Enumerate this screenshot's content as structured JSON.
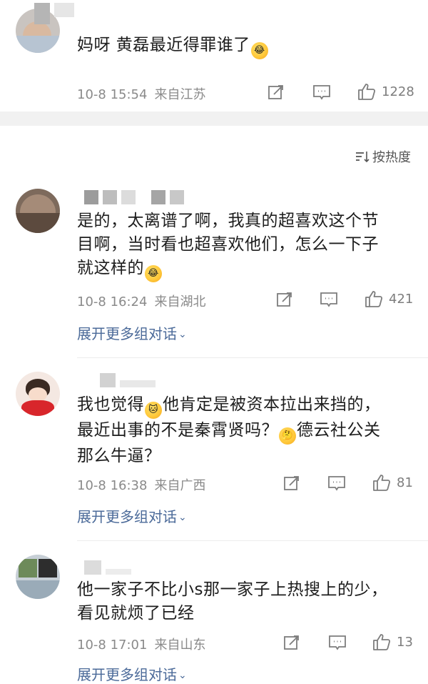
{
  "sort": {
    "label": "按热度"
  },
  "expand_label": "展开更多组对话",
  "comments": [
    {
      "text": "妈呀 黄磊最近得罪谁了",
      "emoji_after": "😂",
      "date": "10-8 15:54",
      "location": "来自江苏",
      "likes": "1228"
    },
    {
      "text_lines": [
        "是的，太离谱了啊，我真的超喜欢这个节",
        "目啊，当时看也超喜欢他们，怎么一下子",
        "就这样的"
      ],
      "emoji_after": "😂",
      "date": "10-8 16:24",
      "location": "来自湖北",
      "likes": "421"
    },
    {
      "text_lines_a": "我也觉得",
      "text_lines_b": "他肯定是被资本拉出来挡的，",
      "line2_a": "最近出事的不是秦霄贤吗？",
      "line2_b": "德云社公关",
      "line3": "那么牛逼？",
      "date": "10-8 16:38",
      "location": "来自广西",
      "likes": "81"
    },
    {
      "text_lines": [
        "他一家子不比小s那一家子上热搜上的少，",
        "看见就烦了已经"
      ],
      "date": "10-8 17:01",
      "location": "来自山东",
      "likes": "13"
    }
  ],
  "colors": {
    "link": "#4b6a99",
    "meta": "#8a8a8a",
    "divider": "#f1f1f1"
  }
}
